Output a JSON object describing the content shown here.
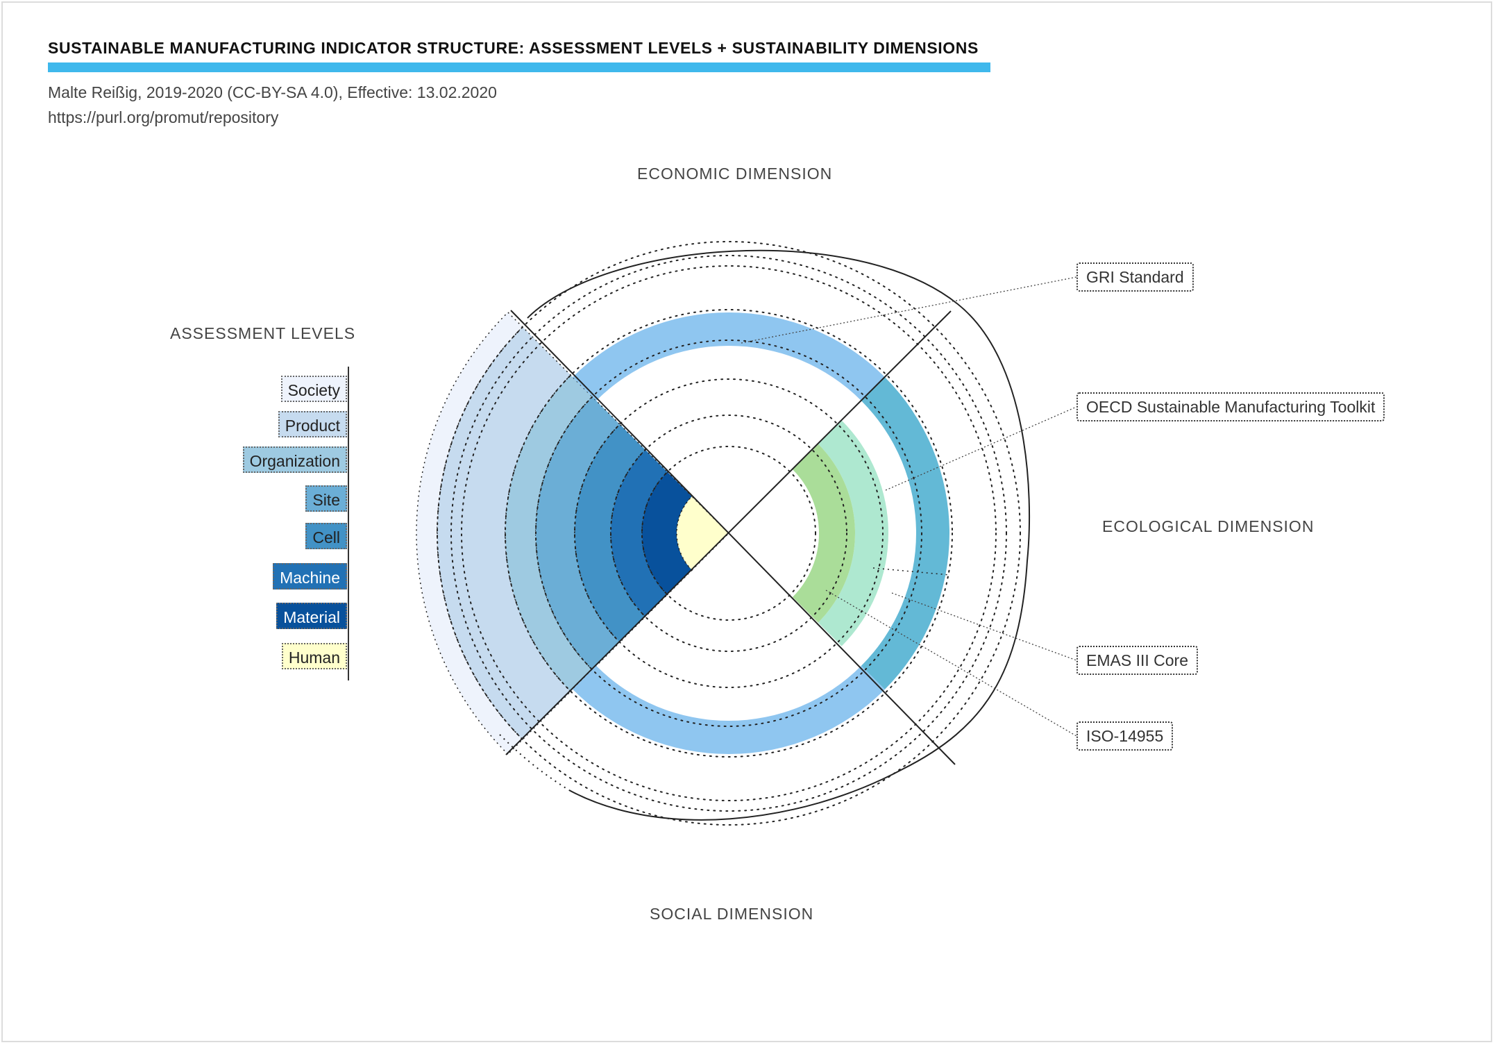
{
  "title": "SUSTAINABLE MANUFACTURING INDICATOR STRUCTURE: ASSESSMENT LEVELS + SUSTAINABILITY DIMENSIONS",
  "author_line": "Malte Reißig, 2019-2020 (CC-BY-SA 4.0), Effective: 13.02.2020",
  "url_line": "https://purl.org/promut/repository",
  "dimensions": {
    "economic": "ECONOMIC DIMENSION",
    "ecological": "ECOLOGICAL DIMENSION",
    "social": "SOCIAL DIMENSION"
  },
  "assessment_levels": {
    "heading": "ASSESSMENT LEVELS",
    "items": [
      {
        "label": "Society",
        "color": "#eef3fc"
      },
      {
        "label": "Product",
        "color": "#c6dbef"
      },
      {
        "label": "Organization",
        "color": "#9ecae1"
      },
      {
        "label": "Site",
        "color": "#6baed6"
      },
      {
        "label": "Cell",
        "color": "#4292c6"
      },
      {
        "label": "Machine",
        "color": "#2171b5"
      },
      {
        "label": "Material",
        "color": "#08519c"
      },
      {
        "label": "Human",
        "color": "#ffffcc"
      }
    ]
  },
  "frameworks": [
    {
      "label": "GRI Standard",
      "color": "#8fc6f0"
    },
    {
      "label": "OECD Sustainable Manufacturing Toolkit",
      "color": "#aee8d0"
    },
    {
      "label": "EMAS III Core",
      "color": "#63b9d6"
    },
    {
      "label": "ISO-14955",
      "color": "#aadd99"
    }
  ]
}
